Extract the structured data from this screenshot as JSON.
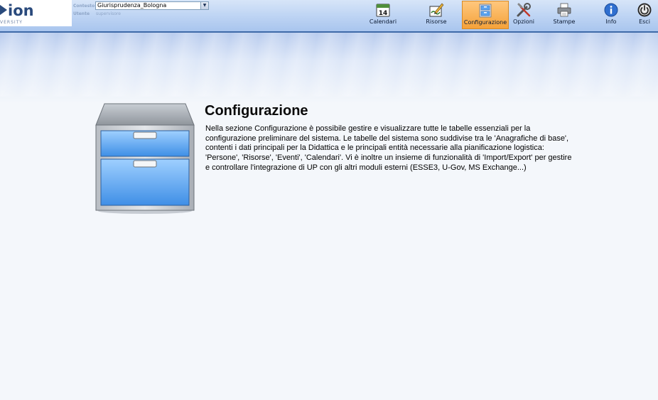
{
  "header": {
    "logo_text": "ion",
    "logo_sub": "VERSITY",
    "context_label": "Contesto",
    "context_value": "Giurisprudenza_Bologna",
    "user_label": "Utente",
    "user_value": "supervisore"
  },
  "toolbar": {
    "items": [
      {
        "label": "Calendari",
        "icon": "calendar-icon",
        "badge": "14"
      },
      {
        "label": "Risorse",
        "icon": "resources-pencil-icon"
      },
      {
        "label": "Configurazione",
        "icon": "cabinet-icon",
        "active": true
      },
      {
        "label": "Opzioni",
        "icon": "tools-icon"
      },
      {
        "label": "Stampe",
        "icon": "printer-icon"
      },
      {
        "label": "Info",
        "icon": "info-icon"
      },
      {
        "label": "Esci",
        "icon": "power-icon"
      }
    ]
  },
  "main": {
    "title": "Configurazione",
    "description": "Nella sezione Configurazione è possibile gestire e visualizzare tutte le tabelle essenziali per la configurazione preliminare del sistema. Le tabelle del sistema sono suddivise tra le 'Anagrafiche di base', contenti i dati principali per la Didattica e le principali entità necessarie alla pianificazione logistica: 'Persone', 'Risorse', 'Eventi', 'Calendari'. Vi è inoltre un insieme di funzionalità di 'Import/Export' per gestire e controllare l'integrazione di UP con gli altri moduli esterni (ESSE3, U-Gov, MS Exchange...)"
  },
  "colors": {
    "active_tab": "#f5a23a",
    "header_border": "#3f6aa8",
    "header_bg": "#bcd3f3"
  }
}
